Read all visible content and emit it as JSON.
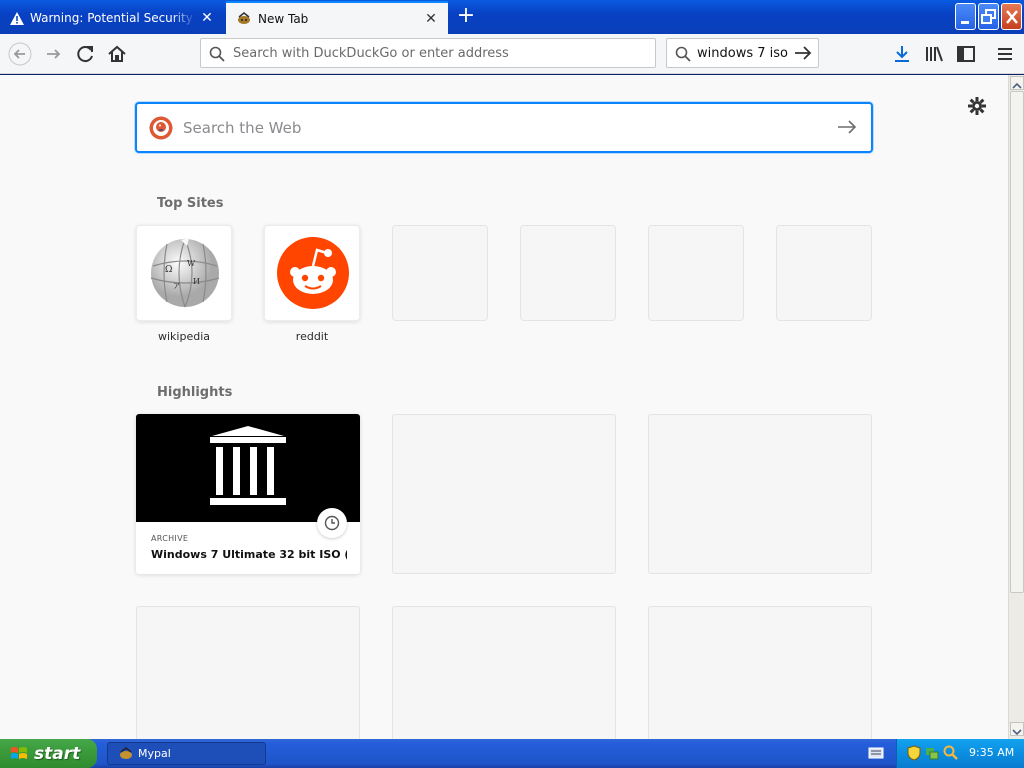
{
  "tabs": [
    {
      "title": "Warning: Potential Security Risk Ahead",
      "active": false
    },
    {
      "title": "New Tab",
      "active": true
    }
  ],
  "toolbar": {
    "url_placeholder": "Search with DuckDuckGo or enter address",
    "search_value": "windows 7 iso"
  },
  "newtab": {
    "search_placeholder": "Search the Web",
    "top_sites_title": "Top Sites",
    "top_sites": [
      {
        "label": "wikipedia",
        "icon": "wikipedia-globe-icon"
      },
      {
        "label": "reddit",
        "icon": "reddit-icon"
      },
      {
        "label": "",
        "icon": ""
      },
      {
        "label": "",
        "icon": ""
      },
      {
        "label": "",
        "icon": ""
      },
      {
        "label": "",
        "icon": ""
      }
    ],
    "highlights_title": "Highlights",
    "highlights": [
      {
        "source": "ARCHIVE",
        "title": "Windows 7 Ultimate 32 bit ISO (...",
        "icon": "archive-building-icon"
      }
    ]
  },
  "taskbar": {
    "start_label": "start",
    "task_label": "Mypal",
    "clock": "9:35 AM"
  },
  "colors": {
    "accent": "#0a84ff",
    "reddit": "#ff4500",
    "xp_blue": "#245edb",
    "xp_green": "#3c9c3c"
  }
}
